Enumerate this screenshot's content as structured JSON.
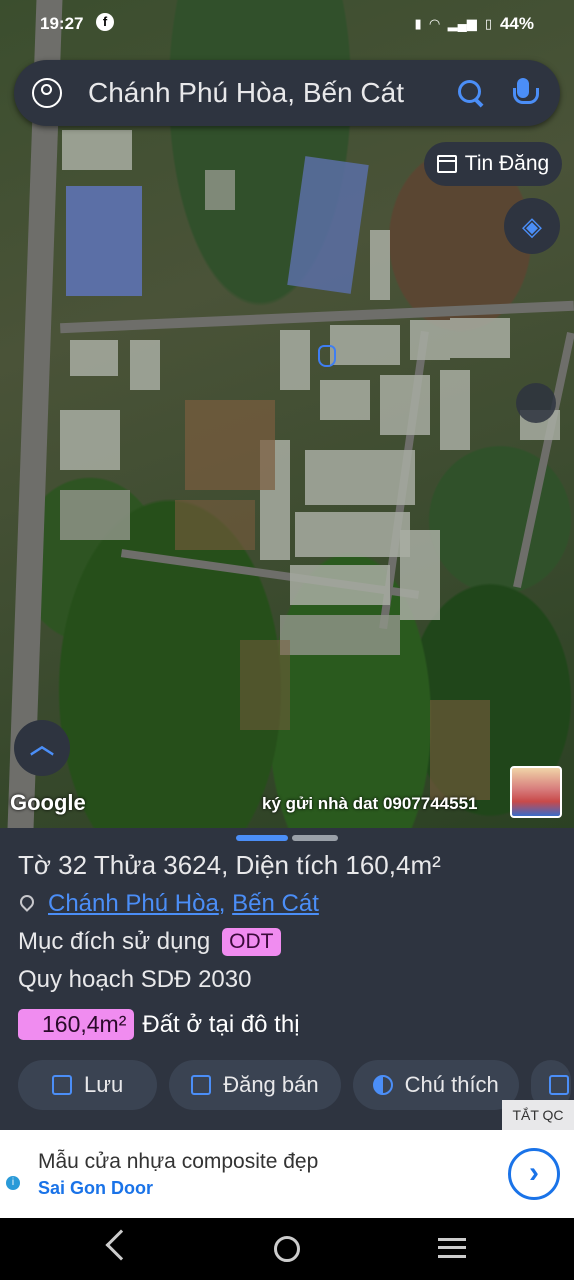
{
  "status_bar": {
    "time": "19:27",
    "battery": "44%"
  },
  "search": {
    "query": "Chánh Phú Hòa, Bến Cát"
  },
  "map": {
    "tin_dang_label": "Tin Đăng",
    "google_label": "Google",
    "contact_text": "ký gửi nhà dat 0907744551"
  },
  "parcel": {
    "title": "Tờ 32 Thửa 3624, Diện tích 160,4m²",
    "ward": "Chánh Phú Hòa",
    "comma": ",",
    "district": "Bến Cát",
    "purpose_label": "Mục đích sử dụng",
    "purpose_code": "ODT",
    "plan_label": "Quy hoạch SDĐ 2030",
    "area_value": "160,4m²",
    "area_desc": "Đất ở tại đô thị"
  },
  "actions": {
    "save": "Lưu",
    "post_sale": "Đăng bán",
    "legend": "Chú thích"
  },
  "ad": {
    "hide_label": "TẮT QC",
    "title": "Mẫu cửa nhựa composite đẹp",
    "advertiser": "Sai Gon Door"
  },
  "colors": {
    "accent": "#4b8ef7",
    "panel": "#2e3440",
    "badge": "#f08cf0"
  }
}
